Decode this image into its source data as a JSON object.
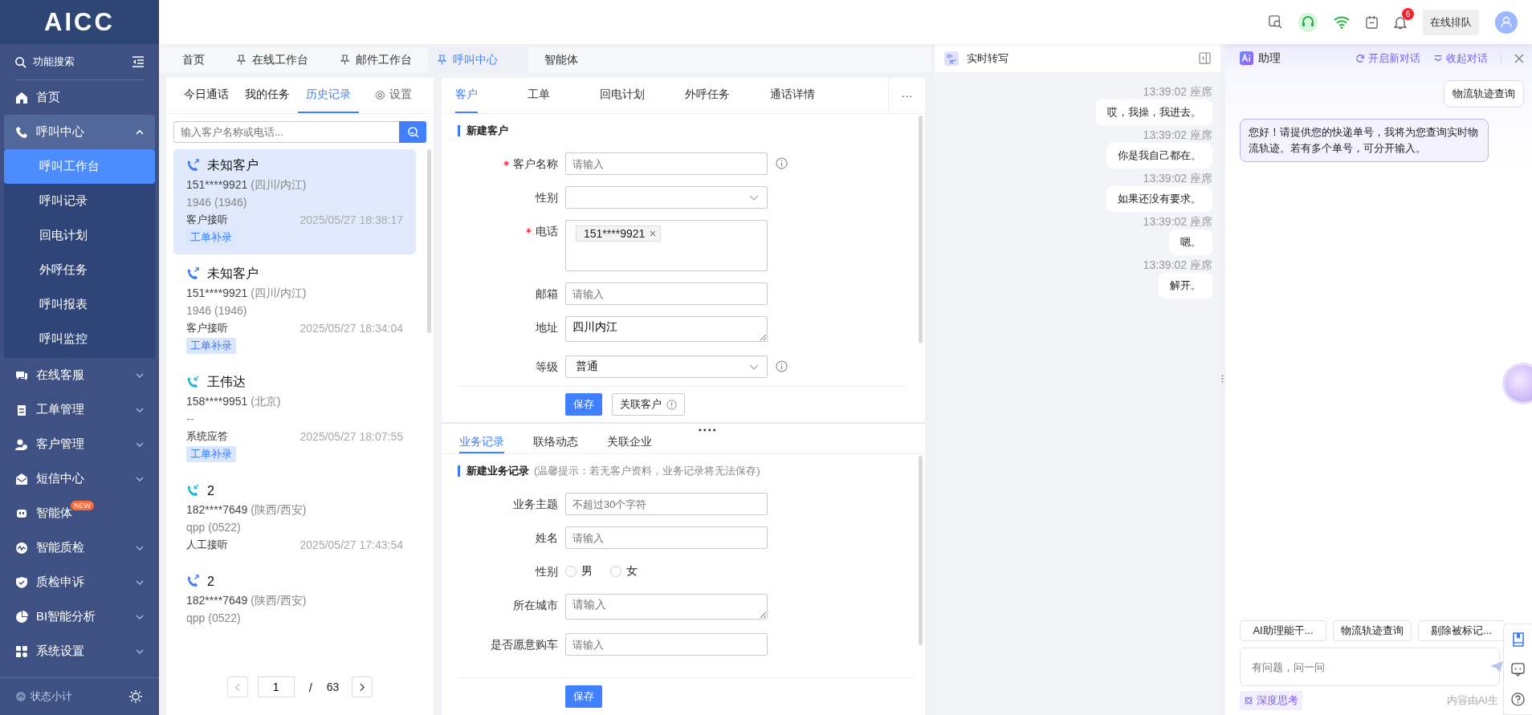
{
  "logo": "AICC",
  "sidebar": {
    "search": "功能搜索",
    "items": [
      {
        "label": "首页"
      },
      {
        "label": "呼叫中心",
        "expanded": true,
        "children": [
          {
            "label": "呼叫工作台",
            "selected": true
          },
          {
            "label": "呼叫记录",
            "selected": false
          },
          {
            "label": "回电计划",
            "selected": false
          },
          {
            "label": "外呼任务",
            "selected": false
          },
          {
            "label": "呼叫报表",
            "selected": false
          },
          {
            "label": "呼叫监控",
            "selected": false
          }
        ]
      },
      {
        "label": "在线客服",
        "expanded": false
      },
      {
        "label": "工单管理",
        "expanded": false
      },
      {
        "label": "客户管理",
        "expanded": false
      },
      {
        "label": "短信中心",
        "expanded": false
      },
      {
        "label": "智能体",
        "badge": "NEW"
      },
      {
        "label": "智能质检",
        "expanded": false
      },
      {
        "label": "质检申诉",
        "expanded": false
      },
      {
        "label": "BI智能分析",
        "expanded": false
      },
      {
        "label": "系统设置",
        "expanded": false
      }
    ],
    "footer": "状态小计"
  },
  "topbar": {
    "notification_count": "6",
    "queue_button": "在线排队"
  },
  "page_tabs": [
    {
      "label": "首页",
      "pinned": false,
      "selected": false
    },
    {
      "label": "在线工作台",
      "pinned": true,
      "selected": false
    },
    {
      "label": "邮件工作台",
      "pinned": true,
      "selected": false
    },
    {
      "label": "呼叫中心",
      "pinned": true,
      "selected": true
    },
    {
      "label": "智能体",
      "pinned": false,
      "selected": false
    }
  ],
  "call_panel": {
    "tabs": [
      {
        "label": "今日通话",
        "kind": "tab",
        "selected": false
      },
      {
        "label": "我的任务",
        "kind": "tab",
        "selected": false
      },
      {
        "label": "历史记录",
        "kind": "tab",
        "selected": true
      },
      {
        "label": "设置",
        "kind": "settings",
        "selected": false
      }
    ],
    "search": {
      "placeholder": "输入客户名称或电话..."
    },
    "calls": [
      {
        "name": "未知客户",
        "incoming": false,
        "phone": "151****9921",
        "region": "(四川/内江)",
        "line": "1946 (1946)",
        "status": "客户接听",
        "time": "2025/05/27 18:38:17",
        "tag": "工单补录",
        "selected": true
      },
      {
        "name": "未知客户",
        "incoming": false,
        "phone": "151****9921",
        "region": "(四川/内江)",
        "line": "1946 (1946)",
        "status": "客户接听",
        "time": "2025/05/27 18:34:04",
        "tag": "工单补录",
        "selected": false
      },
      {
        "name": "王伟达",
        "incoming": true,
        "phone": "158****9951",
        "region": "(北京)",
        "line": "--",
        "status": "系统应答",
        "time": "2025/05/27 18:07:55",
        "tag": "工单补录",
        "selected": false
      },
      {
        "name": "2",
        "incoming": true,
        "phone": "182****7649",
        "region": "(陕西/西安)",
        "line": "qpp (0522)",
        "status": "人工接听",
        "time": "2025/05/27 17:43:54",
        "selected": false
      },
      {
        "name": "2",
        "incoming": false,
        "phone": "182****7649",
        "region": "(陕西/西安)",
        "line": "qpp (0522)",
        "selected": false
      }
    ],
    "pagination": {
      "page": "1",
      "separator": "/",
      "total": "63"
    }
  },
  "customer_panel": {
    "tabs": [
      {
        "label": "客户",
        "selected": true
      },
      {
        "label": "工单",
        "selected": false
      },
      {
        "label": "回电计划",
        "selected": false
      },
      {
        "label": "外呼任务",
        "selected": false
      },
      {
        "label": "通话详情",
        "selected": false
      }
    ],
    "more": "···",
    "title": "新建客户",
    "fields": [
      {
        "label": "客户名称",
        "kind": "text",
        "required": true,
        "placeholder": "请输入",
        "info": true
      },
      {
        "label": "性别",
        "kind": "select"
      },
      {
        "label": "电话",
        "kind": "tags",
        "required": true,
        "tags": [
          "151****9921"
        ]
      },
      {
        "label": "邮箱",
        "kind": "text",
        "placeholder": "请输入"
      },
      {
        "label": "地址",
        "kind": "textarea",
        "value": "四川内江"
      },
      {
        "label": "等级",
        "kind": "select",
        "value": "普通",
        "info": true
      }
    ],
    "buttons": [
      {
        "label": "保存",
        "kind": "primary"
      },
      {
        "label": "关联客户",
        "kind": "info"
      }
    ]
  },
  "record_panel": {
    "tabs": [
      {
        "label": "业务记录",
        "selected": true
      },
      {
        "label": "联络动态",
        "selected": false
      },
      {
        "label": "关联企业",
        "selected": false
      }
    ],
    "title": "新建业务记录",
    "hint": "(温馨提示：若无客户资料，业务记录将无法保存)",
    "fields": [
      {
        "label": "业务主题",
        "kind": "text",
        "placeholder": "不超过30个字符"
      },
      {
        "label": "姓名",
        "kind": "text",
        "placeholder": "请输入"
      },
      {
        "label": "性别",
        "kind": "radio",
        "options": [
          {
            "label": "男",
            "checked": false
          },
          {
            "label": "女",
            "checked": false
          }
        ]
      },
      {
        "label": "所在城市",
        "kind": "textarea",
        "placeholder": "请输入"
      },
      {
        "label": "是否愿意购车",
        "kind": "text",
        "placeholder": "请输入"
      }
    ],
    "save": "保存"
  },
  "transcript": {
    "title": "实时转写",
    "messages": [
      {
        "time": "13:39:02",
        "role": "座席",
        "text": "哎，我操，我进去。"
      },
      {
        "time": "13:39:02",
        "role": "座席",
        "text": "你是我自己都在。"
      },
      {
        "time": "13:39:02",
        "role": "座席",
        "text": "如果还没有要求。"
      },
      {
        "time": "13:39:02",
        "role": "座席",
        "text": "嗯。"
      },
      {
        "time": "13:39:02",
        "role": "座席",
        "text": "解开。"
      }
    ]
  },
  "assistant": {
    "title": "助理",
    "new_chat": "开启新对话",
    "collapse": "收起对话",
    "messages": [
      {
        "kind": "user",
        "text": "物流轨迹查询"
      },
      {
        "kind": "bot",
        "text": "您好！请提供您的快递单号，我将为您查询实时物流轨迹。若有多个单号，可分开输入。"
      }
    ],
    "suggestions": [
      "AI助理能干...",
      "物流轨迹查询",
      "剔除被标记..."
    ],
    "input": {
      "placeholder": "有问题，问一问"
    },
    "deep_think": "深度思考",
    "disclaimer": "内容由AI生"
  }
}
